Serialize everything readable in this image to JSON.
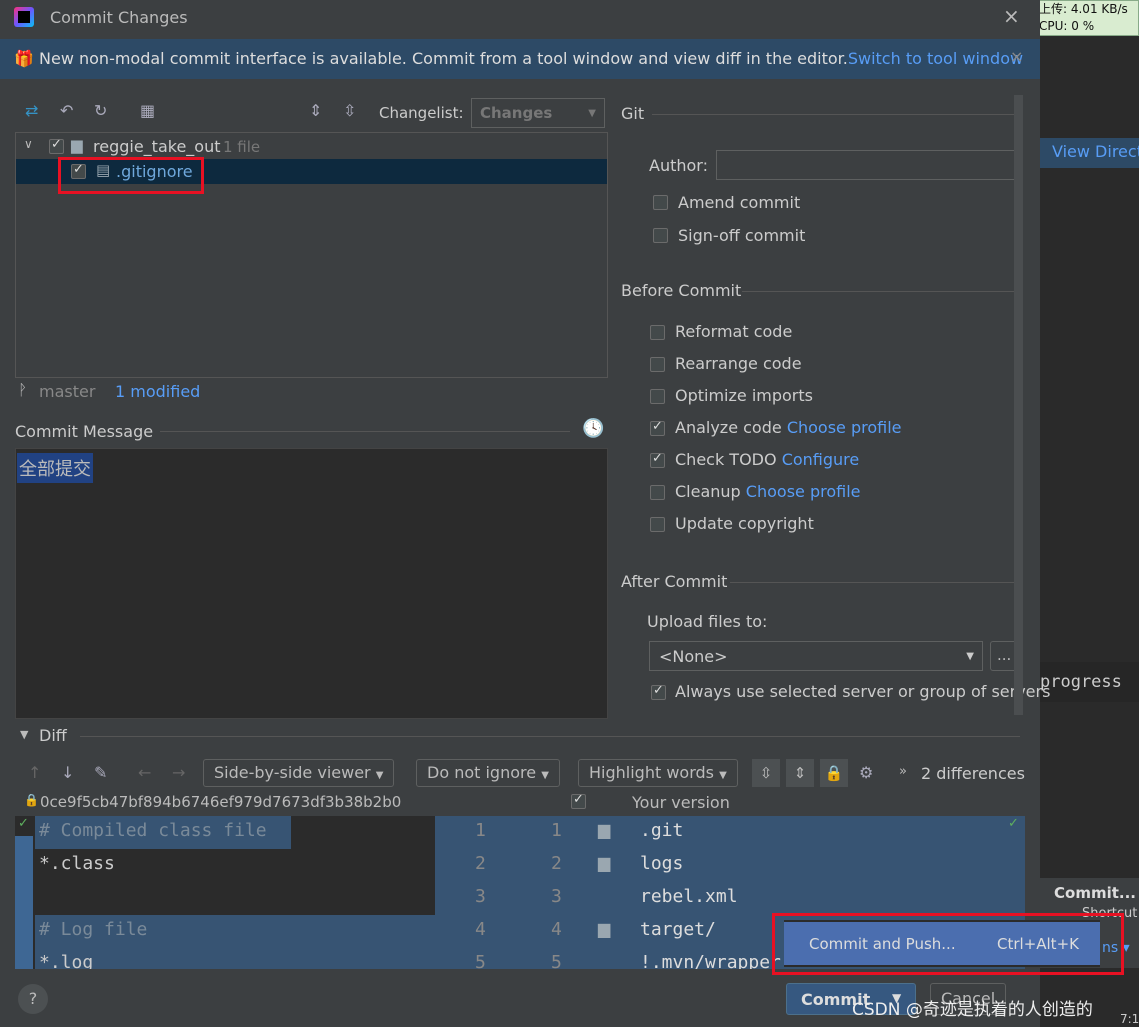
{
  "window": {
    "title": "Commit Changes",
    "close": "×"
  },
  "banner": {
    "text": "New non-modal commit interface is available. Commit from a tool window and view diff in the editor.",
    "link": "Switch to tool window",
    "close": "×"
  },
  "toolbar": {
    "changelist_label": "Changelist:",
    "changelist_value": "Changes"
  },
  "tree": {
    "root": "reggie_take_out",
    "root_count": "1 file",
    "file": ".gitignore"
  },
  "status": {
    "branch": "master",
    "modified": "1 modified"
  },
  "commit_message": {
    "label": "Commit Message",
    "value": "全部提交"
  },
  "git": {
    "header": "Git",
    "author_label": "Author:",
    "author_value": "",
    "amend": "Amend commit",
    "signoff": "Sign-off commit"
  },
  "before_commit": {
    "header": "Before Commit",
    "items": [
      {
        "label": "Reformat code",
        "checked": false,
        "link": ""
      },
      {
        "label": "Rearrange code",
        "checked": false,
        "link": ""
      },
      {
        "label": "Optimize imports",
        "checked": false,
        "link": ""
      },
      {
        "label": "Analyze code",
        "checked": true,
        "link": "Choose profile"
      },
      {
        "label": "Check TODO",
        "checked": true,
        "link": "Configure"
      },
      {
        "label": "Cleanup",
        "checked": false,
        "link": "Choose profile"
      },
      {
        "label": "Update copyright",
        "checked": false,
        "link": ""
      }
    ]
  },
  "after_commit": {
    "header": "After Commit",
    "upload_label": "Upload files to:",
    "upload_value": "<None>",
    "more": "...",
    "always_use": "Always use selected server or group of servers"
  },
  "diff": {
    "header": "Diff",
    "viewer": "Side-by-side viewer",
    "ignore": "Do not ignore",
    "highlight": "Highlight words",
    "differences": "2 differences",
    "left_title": "0ce9f5cb47bf894b6746ef979d7673df3b38b2b0",
    "right_title": "Your version",
    "left_lines": [
      "# Compiled class file",
      "*.class",
      "",
      "# Log file",
      "*.log"
    ],
    "left_nums": [
      "1",
      "2",
      "3",
      "4",
      "5"
    ],
    "right_nums": [
      "1",
      "2",
      "3",
      "4",
      "5"
    ],
    "right_lines": [
      ".git",
      "logs",
      "rebel.xml",
      "target/",
      "!.mvn/wrapper"
    ]
  },
  "popup": {
    "label": "Commit and Push...",
    "shortcut": "Ctrl+Alt+K"
  },
  "buttons": {
    "help": "?",
    "commit": "Commit",
    "cancel": "Cancel"
  },
  "background": {
    "net": "上传: 4.01 KB/s",
    "cpu": "CPU: 0 %",
    "view": "View Direct",
    "progress": "progress",
    "commit": "Commit...",
    "shortcut": "Shortcut 'C",
    "ns": "ns ▾",
    "watermark": "CSDN @奇迹是执着的人创造的",
    "time": "7:1"
  },
  "colors": {
    "accent": "#589df6",
    "selection": "#0d293e",
    "highlight": "#e81123"
  }
}
